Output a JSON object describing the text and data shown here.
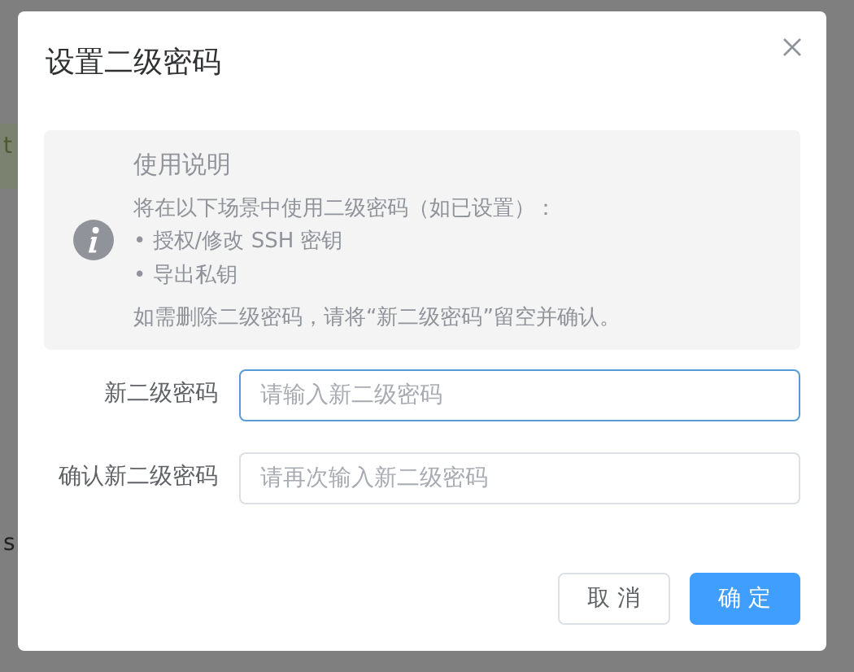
{
  "background": {
    "fragments": [
      {
        "text": "t",
        "kind": "alert"
      },
      {
        "text": "s",
        "kind": "row"
      }
    ]
  },
  "dialog": {
    "title": "设置二级密码",
    "notice": {
      "title": "使用说明",
      "intro": "将在以下场景中使用二级密码（如已设置）：",
      "bullets": [
        "• 授权/修改 SSH 密钥",
        "• 导出私钥"
      ],
      "footer": "如需删除二级密码，请将“新二级密码”留空并确认。"
    },
    "fields": [
      {
        "label": "新二级密码",
        "placeholder": "请输入新二级密码",
        "focused": true
      },
      {
        "label": "确认新二级密码",
        "placeholder": "请再次输入新二级密码",
        "focused": false
      }
    ],
    "buttons": [
      {
        "label": "取 消",
        "kind": "default"
      },
      {
        "label": "确 定",
        "kind": "primary"
      }
    ]
  }
}
